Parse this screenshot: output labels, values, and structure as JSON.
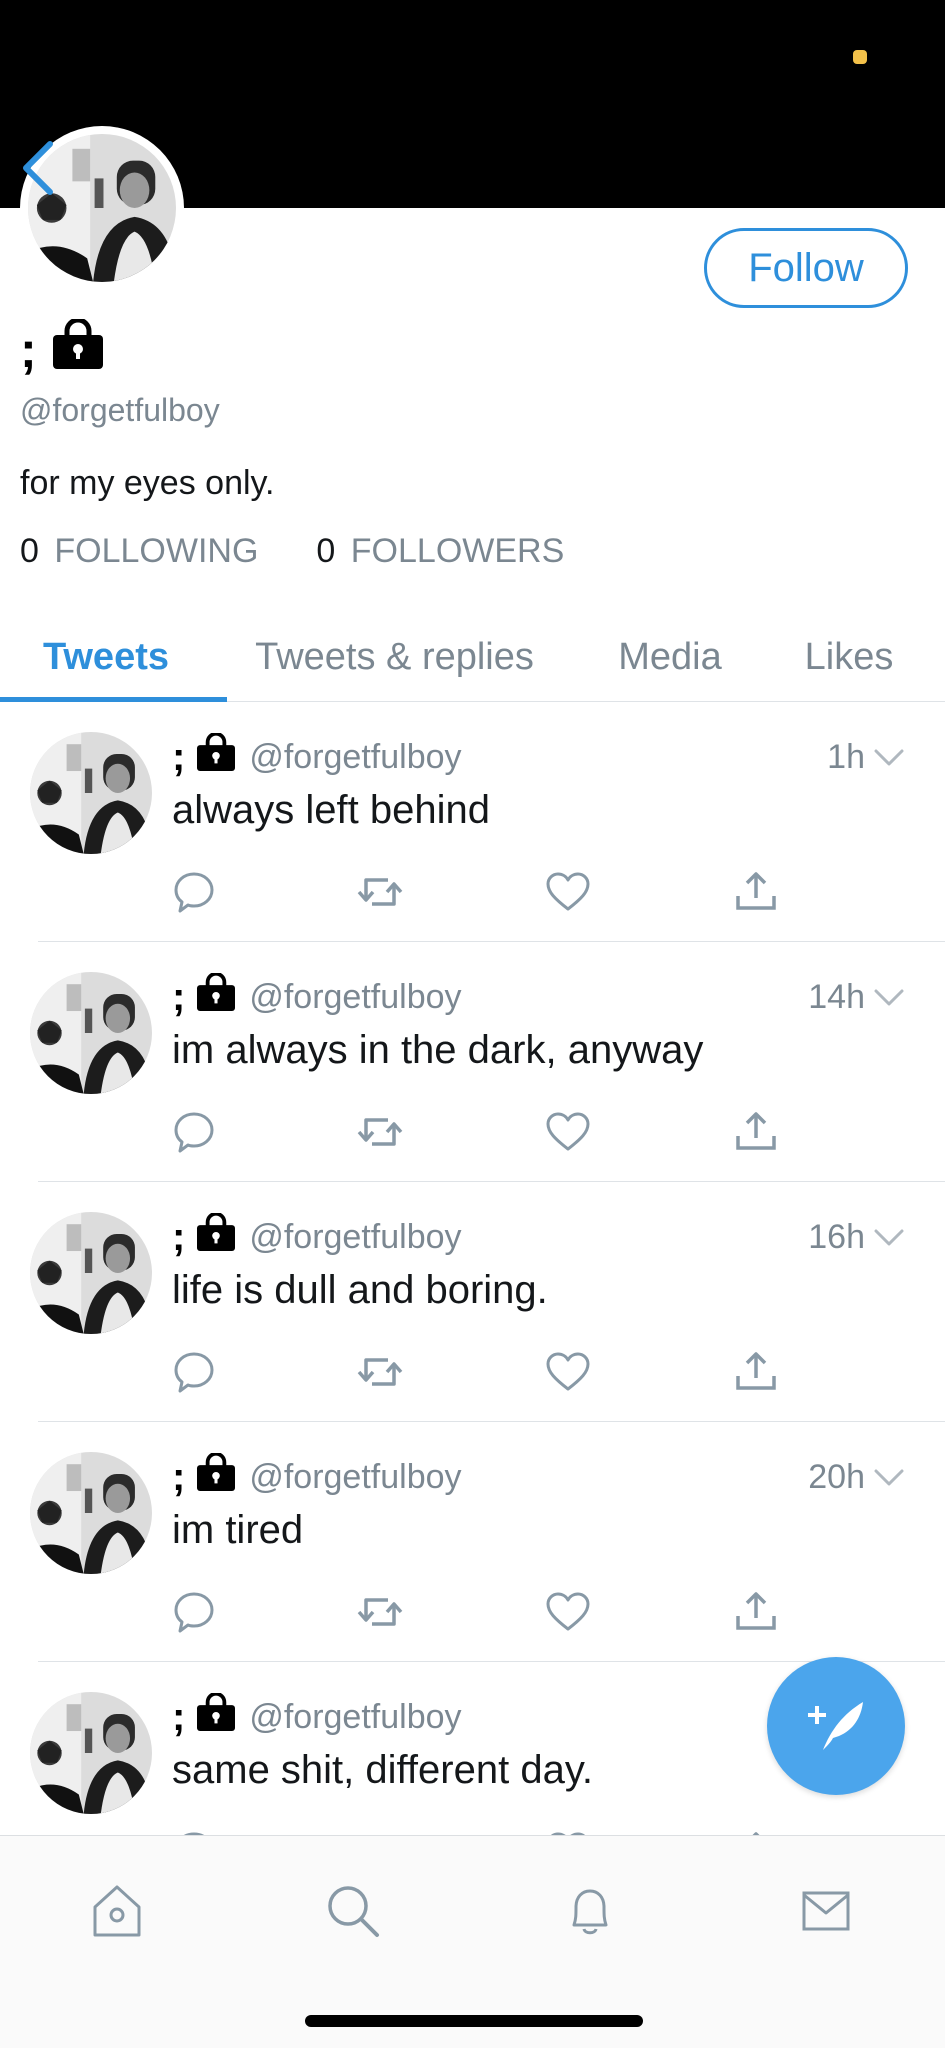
{
  "profile": {
    "name": ";",
    "handle": "@forgetfulboy",
    "bio": "for my eyes only.",
    "follow_label": "Follow"
  },
  "stats": {
    "following_count": "0",
    "following_label": "FOLLOWING",
    "followers_count": "0",
    "followers_label": "FOLLOWERS"
  },
  "tabs": [
    {
      "label": "Tweets",
      "active": true
    },
    {
      "label": "Tweets & replies",
      "active": false
    },
    {
      "label": "Media",
      "active": false
    },
    {
      "label": "Likes",
      "active": false
    }
  ],
  "tweets": [
    {
      "name": ";",
      "handle": "@forgetfulboy",
      "time": "1h",
      "text": "always left behind"
    },
    {
      "name": ";",
      "handle": "@forgetfulboy",
      "time": "14h",
      "text": "im always in the dark, anyway"
    },
    {
      "name": ";",
      "handle": "@forgetfulboy",
      "time": "16h",
      "text": "life is dull and boring."
    },
    {
      "name": ";",
      "handle": "@forgetfulboy",
      "time": "20h",
      "text": "im tired"
    },
    {
      "name": ";",
      "handle": "@forgetfulboy",
      "time": "",
      "text": "same shit, different day."
    }
  ],
  "nav": [
    "home-icon",
    "search-icon",
    "notifications-icon",
    "messages-icon"
  ],
  "colors": {
    "accent": "#2e8fdb",
    "compose": "#4ba5ec",
    "muted": "#7b8791",
    "banner": "#000000"
  }
}
